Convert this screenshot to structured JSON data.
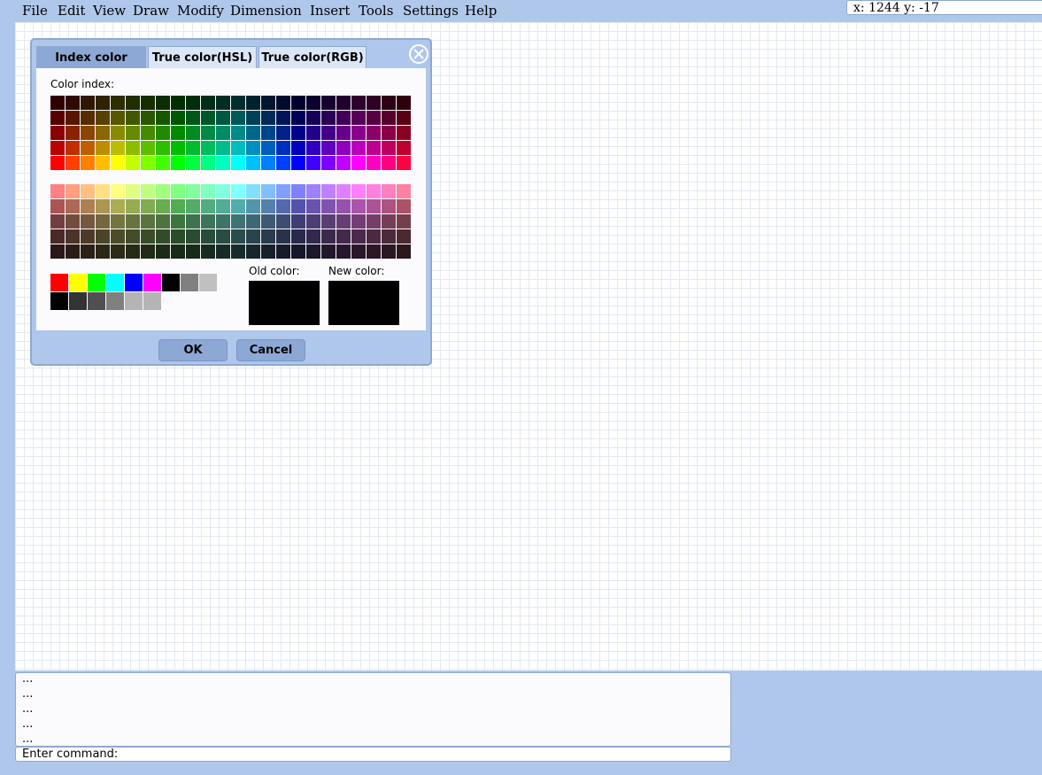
{
  "menu": [
    "File",
    "Edit",
    "View",
    "Draw",
    "Modify",
    "Dimension",
    "Insert",
    "Tools",
    "Settings",
    "Help"
  ],
  "coords": "x: 1244 y: -17",
  "dialog": {
    "close_icon": "close-circle-icon",
    "tabs": [
      "Index color",
      "True color(HSL)",
      "True color(RGB)"
    ],
    "active_tab": "Index color",
    "color_index_label": "Color index:",
    "standard_colors": [
      "#ff0000",
      "#ffff00",
      "#00ff00",
      "#00ffff",
      "#0000ff",
      "#ff00ff",
      "#000000",
      "#808080",
      "#c0c0c0"
    ],
    "gray_colors": [
      "#000000",
      "#333333",
      "#505050",
      "#808080",
      "#b4b4b4",
      "#b4b4b4"
    ],
    "old_color_label": "Old color:",
    "new_color_label": "New color:",
    "old_color": "#000000",
    "new_color": "#000000",
    "ok_label": "OK",
    "cancel_label": "Cancel"
  },
  "command": {
    "history": [
      "...",
      "...",
      "...",
      "...",
      "..."
    ],
    "prompt": "Enter command:"
  }
}
